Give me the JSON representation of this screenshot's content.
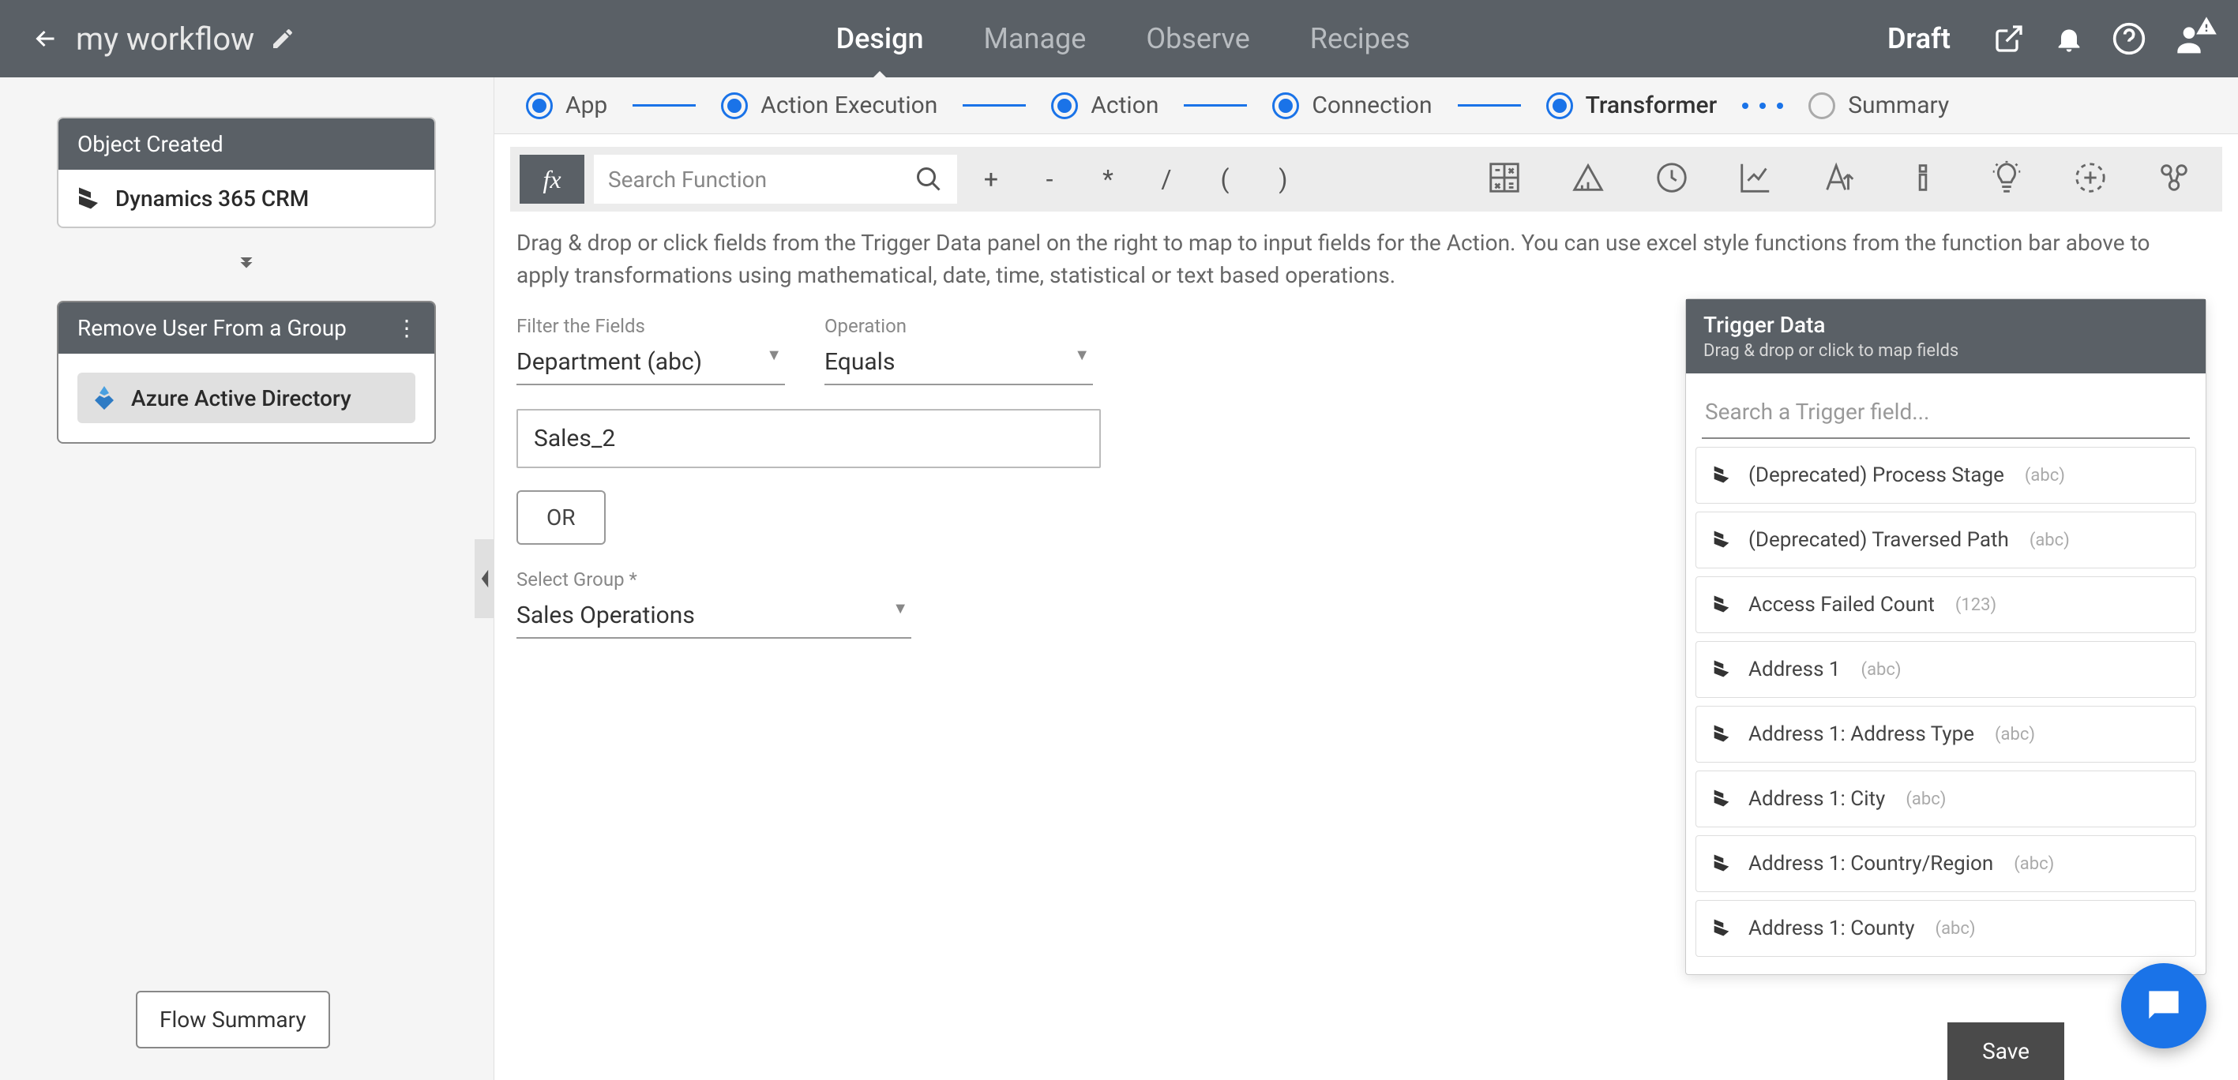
{
  "header": {
    "workflow_name": "my workflow",
    "tabs": {
      "design": "Design",
      "manage": "Manage",
      "observe": "Observe",
      "recipes": "Recipes"
    },
    "status": "Draft"
  },
  "sidebar": {
    "card1": {
      "title": "Object Created",
      "app": "Dynamics 365 CRM"
    },
    "card2": {
      "title": "Remove User From a Group",
      "app": "Azure Active Directory"
    },
    "flow_summary_btn": "Flow Summary"
  },
  "stepper": {
    "app": "App",
    "action_execution": "Action Execution",
    "action": "Action",
    "connection": "Connection",
    "transformer": "Transformer",
    "summary": "Summary"
  },
  "function_bar": {
    "search_placeholder": "Search Function",
    "ops": {
      "plus": "+",
      "minus": "-",
      "mult": "*",
      "div": "/",
      "lparen": "(",
      "rparen": ")"
    }
  },
  "instructions": "Drag & drop or click fields from the Trigger Data panel on the right to map to input fields for the Action. You can use excel style functions from the function bar above to apply transformations using mathematical, date, time, statistical or text based operations.",
  "form": {
    "filter_label": "Filter the Fields",
    "filter_value": "Department (abc)",
    "operation_label": "Operation",
    "operation_value": "Equals",
    "text_value": "Sales_2",
    "or_label": "OR",
    "select_group_label": "Select Group *",
    "select_group_value": "Sales Operations"
  },
  "trigger_panel": {
    "title": "Trigger Data",
    "subtitle": "Drag & drop or click to map fields",
    "search_placeholder": "Search a Trigger field...",
    "items": [
      {
        "name": "(Deprecated) Process Stage",
        "type": "(abc)"
      },
      {
        "name": "(Deprecated) Traversed Path",
        "type": "(abc)"
      },
      {
        "name": "Access Failed Count",
        "type": "(123)"
      },
      {
        "name": "Address 1",
        "type": "(abc)"
      },
      {
        "name": "Address 1: Address Type",
        "type": "(abc)"
      },
      {
        "name": "Address 1: City",
        "type": "(abc)"
      },
      {
        "name": "Address 1: Country/Region",
        "type": "(abc)"
      },
      {
        "name": "Address 1: County",
        "type": "(abc)"
      }
    ]
  },
  "save_btn": "Save"
}
